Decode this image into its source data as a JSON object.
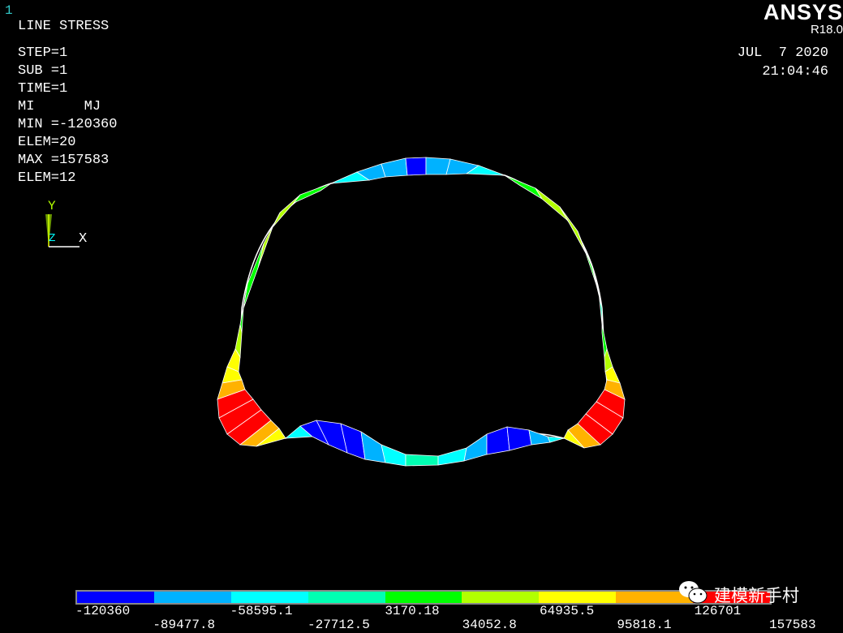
{
  "window_number": "1",
  "plot": {
    "title": "LINE STRESS",
    "step": "STEP=1",
    "sub": "SUB =1",
    "time": "TIME=1",
    "mi_mj": "MI      MJ",
    "min": "MIN =-120360",
    "min_elem": "ELEM=20",
    "max": "MAX =157583",
    "max_elem": "ELEM=12"
  },
  "header": {
    "brand": "ANSYS",
    "release": "R18.0",
    "date": "JUL  7 2020",
    "clock": "21:04:46"
  },
  "triad": {
    "y_label": "Y",
    "z_label": "Z",
    "x_label": "X"
  },
  "legend": {
    "colors": [
      "#0000ff",
      "#00b2ff",
      "#00ffff",
      "#00ffb2",
      "#00ff00",
      "#b2ff00",
      "#ffff00",
      "#ffb200",
      "#ff0000"
    ],
    "top_labels": [
      "-120360",
      "-58595.1",
      "3170.18",
      "64935.5",
      "126701"
    ],
    "bottom_labels": [
      "-89477.8",
      "-27712.5",
      "34052.8",
      "95818.1",
      "157583"
    ]
  },
  "watermark": {
    "icon": "wechat-icon",
    "text": "建模新手村"
  }
}
